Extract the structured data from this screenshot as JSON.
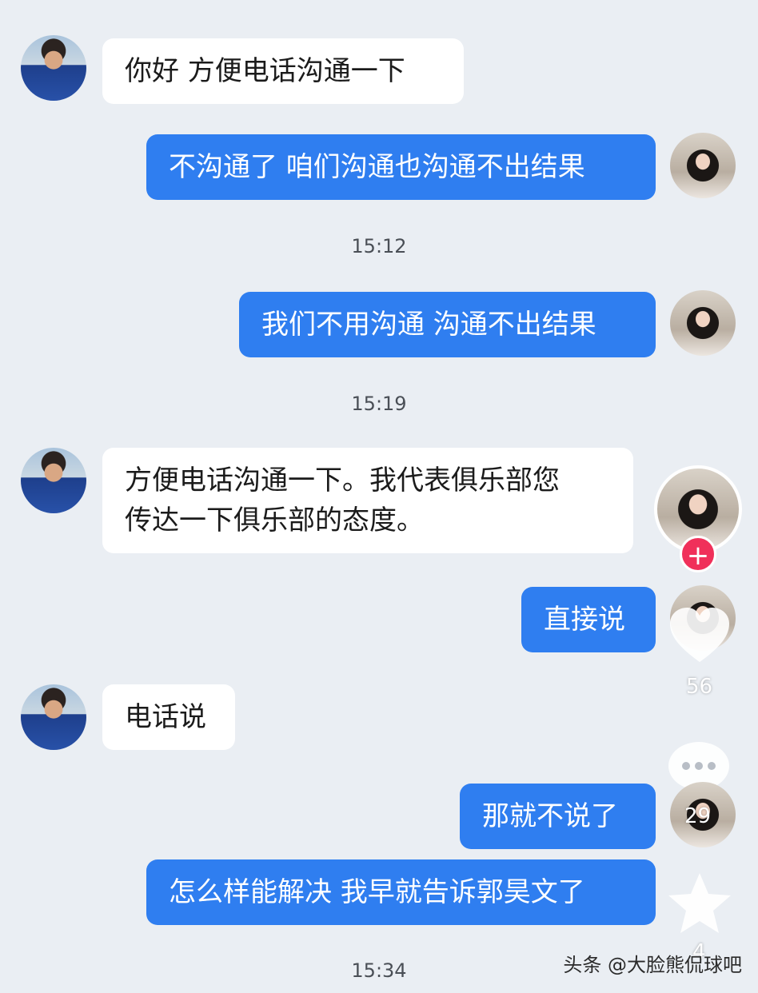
{
  "messages": [
    {
      "side": "in",
      "text": "你好 方便电话沟通一下"
    },
    {
      "side": "out",
      "text": "不沟通了 咱们沟通也沟通不出结果"
    },
    {
      "side": "out",
      "text": "我们不用沟通 沟通不出结果"
    },
    {
      "side": "in",
      "line1": "方便电话沟通一下。我代表俱乐部您",
      "line2": "传达一下俱乐部的态度。"
    },
    {
      "side": "out",
      "text": "直接说"
    },
    {
      "side": "in",
      "text": "电话说"
    },
    {
      "side": "out",
      "text": "那就不说了"
    },
    {
      "side": "out",
      "text": "怎么样能解决 我早就告诉郭昊文了"
    }
  ],
  "timestamps": [
    "15:12",
    "15:19",
    "15:34"
  ],
  "side_panel": {
    "plus_icon": "plus-icon",
    "like_icon": "heart-icon",
    "like_count": "56",
    "comment_icon": "comment-icon",
    "comment_count": "29",
    "favorite_icon": "star-icon",
    "favorite_count": "4"
  },
  "watermark": "头条 @大脸熊侃球吧",
  "colors": {
    "background": "#eaeef3",
    "incoming_bubble": "#ffffff",
    "outgoing_bubble": "#2f7ef0",
    "follow_badge": "#f0305a"
  }
}
